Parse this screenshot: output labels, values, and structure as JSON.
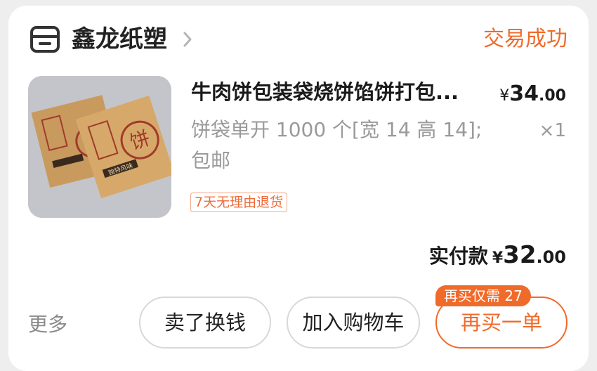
{
  "store": {
    "name": "鑫龙纸塑",
    "icon": "store-icon"
  },
  "order": {
    "status": "交易成功"
  },
  "product": {
    "title": "牛肉饼包装袋烧饼馅饼打包...",
    "spec": "饼袋单开 1000 个[宽 14 高 14]; 包邮",
    "price_symbol": "¥",
    "price_int": "34",
    "price_dec": ".00",
    "quantity": "×1",
    "return_badge": "7天无理由退货",
    "image_text": {
      "bag_char": "饼",
      "bag_banner": "独特风味"
    }
  },
  "payment": {
    "label": "实付款",
    "symbol": "¥",
    "int": "32",
    "dec": ".00"
  },
  "actions": {
    "more": "更多",
    "sell": "卖了换钱",
    "add_cart": "加入购物车",
    "rebuy": "再买一单",
    "rebuy_tag": "再买仅需 27"
  },
  "colors": {
    "accent": "#f06a2a",
    "muted_text": "#9a9a9a"
  }
}
